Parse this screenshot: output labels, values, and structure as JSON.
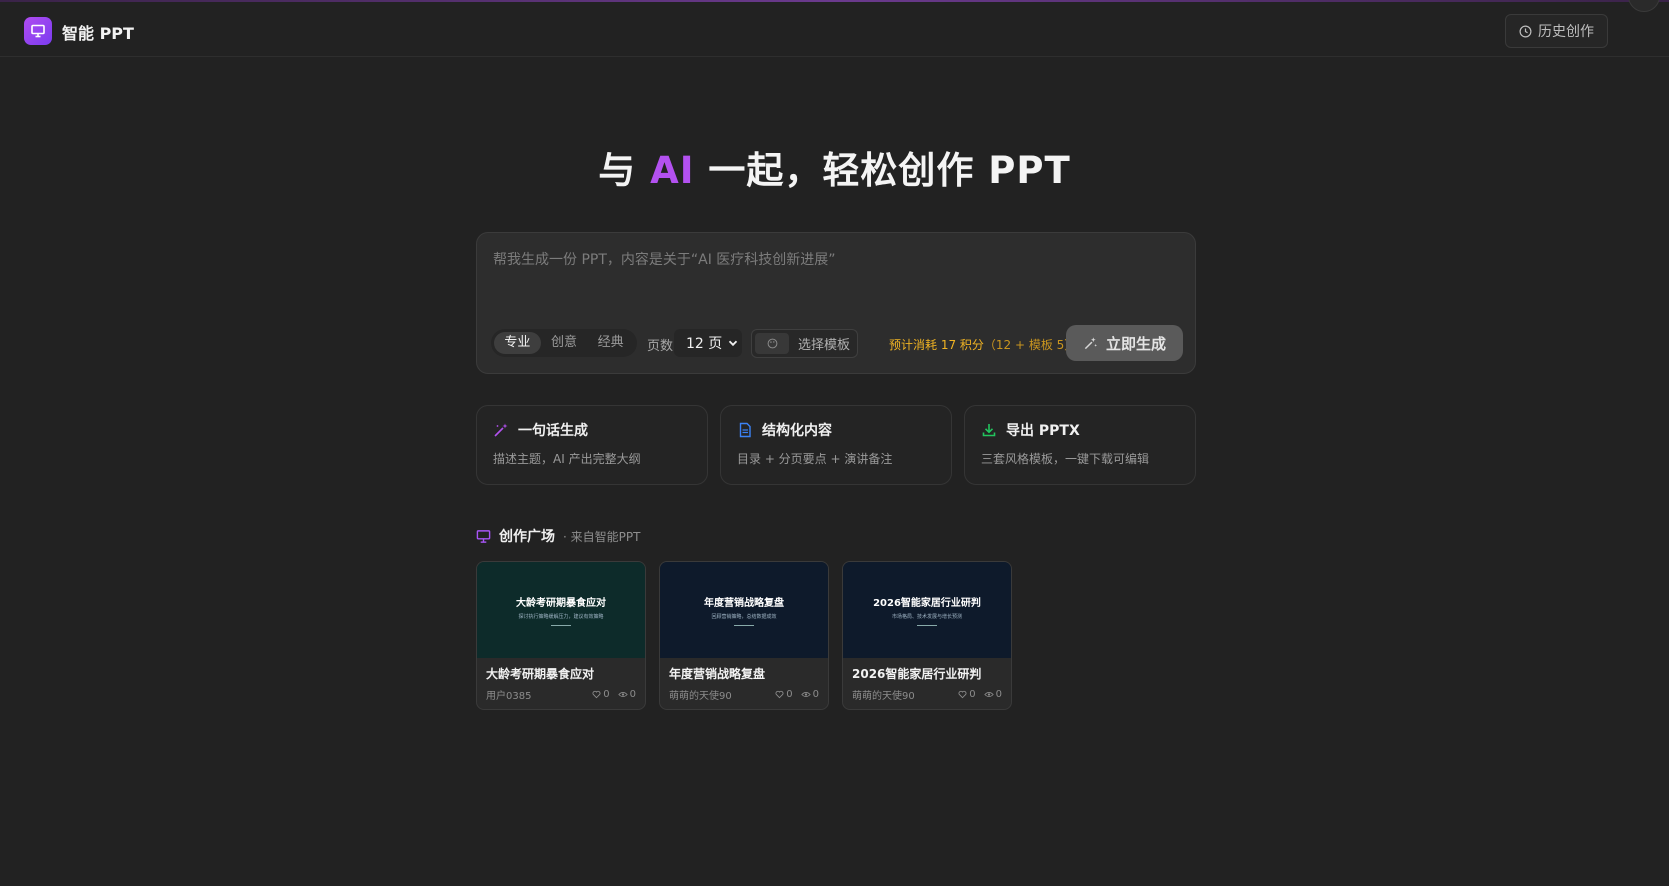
{
  "header": {
    "brand": "智能 PPT",
    "history_label": "历史创作"
  },
  "hero": {
    "prefix": "与 ",
    "highlight": "AI",
    "suffix": " 一起，轻松创作 PPT"
  },
  "prompt": {
    "placeholder": "帮我生成一份 PPT，内容是关于“AI 医疗科技创新进展”",
    "value": ""
  },
  "styles": [
    {
      "label": "专业",
      "active": true
    },
    {
      "label": "创意",
      "active": false
    },
    {
      "label": "经典",
      "active": false
    }
  ],
  "pages": {
    "label": "页数",
    "value": "12 页"
  },
  "template_label": "选择模板",
  "cost": {
    "main": "预计消耗 17 积分",
    "detail": "（12 + 模板 5）"
  },
  "generate_label": "立即生成",
  "features": [
    {
      "icon": "magic-wand-icon",
      "title": "一句话生成",
      "desc": "描述主题，AI 产出完整大纲",
      "color": "#b351f0"
    },
    {
      "icon": "document-icon",
      "title": "结构化内容",
      "desc": "目录 + 分页要点 + 演讲备注",
      "color": "#3b82f6"
    },
    {
      "icon": "download-icon",
      "title": "导出 PPTX",
      "desc": "三套风格模板，一键下载可编辑",
      "color": "#22c55e"
    }
  ],
  "gallery": {
    "title": "创作广场",
    "subtitle": "· 来自智能PPT",
    "cards": [
      {
        "thumb_title": "大龄考研期暴食应对",
        "thumb_sub": "探讨执行策略缓解压力，建议有效策略",
        "thumb_bg": "#0d2b2a",
        "title": "大龄考研期暴食应对",
        "author": "用户0385",
        "likes": "0",
        "views": "0"
      },
      {
        "thumb_title": "年度营销战略复盘",
        "thumb_sub": "回顾营销策略，总结数据成效",
        "thumb_bg": "#0e1a2b",
        "title": "年度营销战略复盘",
        "author": "萌萌的天使90",
        "likes": "0",
        "views": "0"
      },
      {
        "thumb_title": "2026智能家居行业研判",
        "thumb_sub": "市场格局、技术发展与增长预测",
        "thumb_bg": "#0e1a2b",
        "title": "2026智能家居行业研判",
        "author": "萌萌的天使90",
        "likes": "0",
        "views": "0"
      }
    ]
  }
}
